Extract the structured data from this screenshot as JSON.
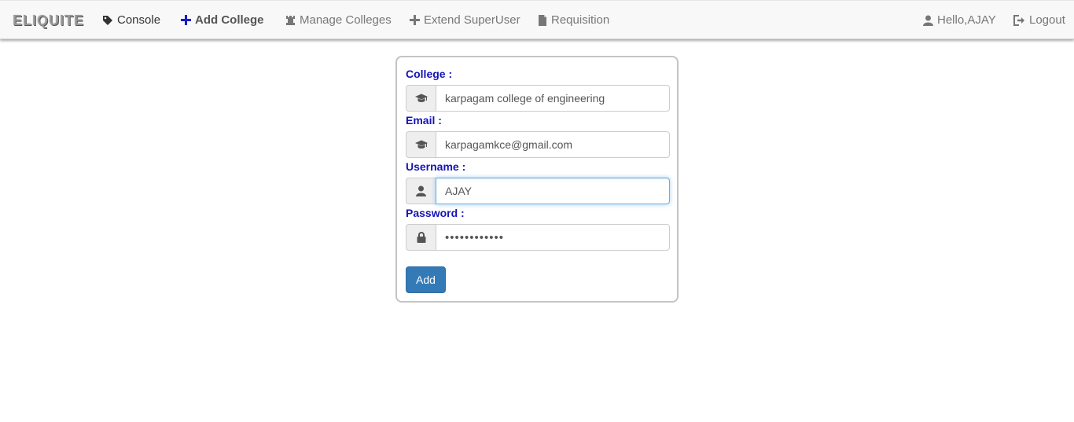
{
  "nav": {
    "brand": "ELIQUITE",
    "items": [
      {
        "label": "Console",
        "icon": "tag-icon"
      },
      {
        "label": "Add College",
        "icon": "plus-icon"
      },
      {
        "label": "Manage Colleges",
        "icon": "tower-icon"
      },
      {
        "label": "Extend SuperUser",
        "icon": "plus-icon"
      },
      {
        "label": "Requisition",
        "icon": "file-icon"
      }
    ],
    "user_greeting": "Hello,AJAY",
    "logout": "Logout"
  },
  "form": {
    "college_label": "College :",
    "college_value": "karpagam college of engineering",
    "email_label": "Email :",
    "email_value": "karpagamkce@gmail.com",
    "username_label": "Username :",
    "username_value": "AJAY",
    "password_label": "Password :",
    "password_value": "passwordabc1",
    "submit_label": "Add"
  },
  "colors": {
    "label_blue": "#1414b8",
    "add_icon_blue": "#1a1ac8",
    "button_blue": "#337ab7"
  }
}
